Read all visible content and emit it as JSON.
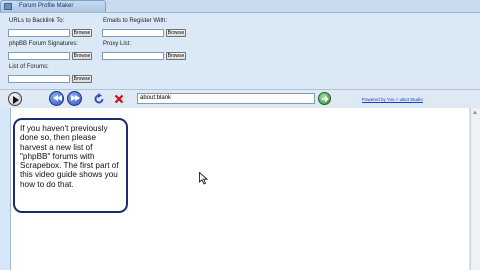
{
  "window": {
    "title": "Forum Profile Maker"
  },
  "form": {
    "urls_backlink_label": "URLs to Backlink To:",
    "emails_register_label": "Emails to Register With:",
    "signatures_label": "phpBB Forum Signatures:",
    "proxy_label": "Proxy List:",
    "forums_label": "List of Forums:",
    "browse_label": "Browse"
  },
  "toolbar": {
    "url_value": "about:blank",
    "powered_by": "Powered by You + uBot Studio"
  },
  "callout": {
    "text": "If you haven't previously done so, then please harvest a new list of \"phpBB\" forums with Scrapebox. The first part of this video guide shows you how to do that."
  },
  "icons": [
    "app-icon",
    "play-icon",
    "back-icon",
    "forward-icon",
    "refresh-icon",
    "stop-icon",
    "go-icon",
    "cursor-icon"
  ]
}
